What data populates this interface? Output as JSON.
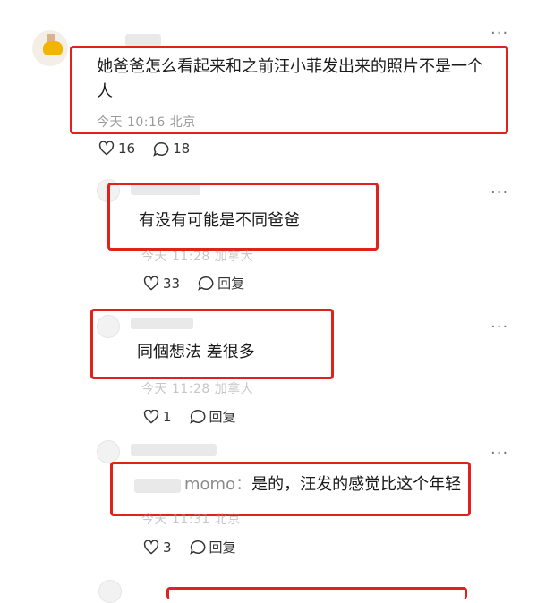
{
  "comments": [
    {
      "text_line1": "她爸爸怎么看起来和之前汪小菲发出来的照片不是一个",
      "text_line2": "人",
      "meta": "今天 10:16 北京",
      "likes": "16",
      "replies": "18",
      "more": "···"
    },
    {
      "text": "有没有可能是不同爸爸",
      "meta": "今天 11:28 加拿大",
      "likes": "33",
      "reply_label": "回复",
      "more": "···"
    },
    {
      "text": "同個想法 差很多",
      "meta": "今天 11:28 加拿大",
      "likes": "1",
      "reply_label": "回复",
      "more": "···"
    },
    {
      "prefix": "momo：",
      "text": "是的，汪发的感觉比这个年轻",
      "meta": "今天 11:31 北京",
      "likes": "3",
      "reply_label": "回复",
      "more": "···"
    }
  ]
}
